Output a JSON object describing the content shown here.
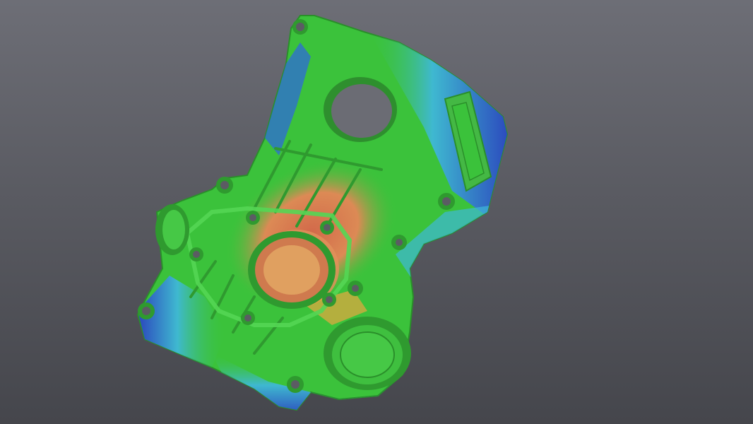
{
  "viewport": {
    "background_top": "#6d6e76",
    "background_bottom": "#45464c"
  },
  "model": {
    "subject": "engine-timing-cover",
    "render": "deviation-color-map",
    "colormap": {
      "nominal": "#3bc23b",
      "positive_high": "#d2694a",
      "positive_mid": "#e8a640",
      "negative_mid": "#3fb8d8",
      "negative_high": "#2a3fc4"
    }
  }
}
